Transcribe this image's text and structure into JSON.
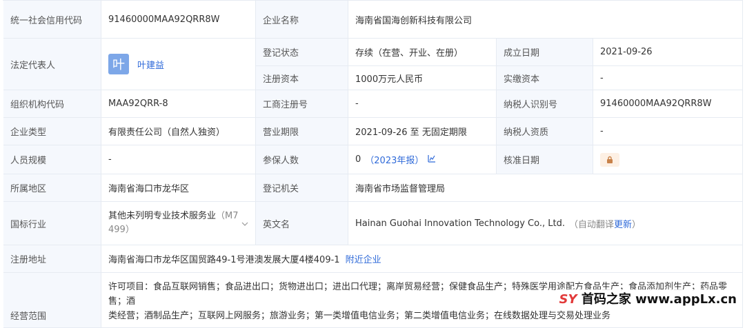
{
  "rows": {
    "credit_code": {
      "label": "统一社会信用代码",
      "value": "91460000MAA92QRR8W"
    },
    "company_name": {
      "label": "企业名称",
      "value": "海南省国海创新科技有限公司"
    },
    "legal_rep": {
      "label": "法定代表人",
      "avatar_char": "叶",
      "name": "叶建益"
    },
    "reg_status": {
      "label": "登记状态",
      "value": "存续（在营、开业、在册）"
    },
    "founded": {
      "label": "成立日期",
      "value": "2021-09-26"
    },
    "reg_capital": {
      "label": "注册资本",
      "value": "1000万元人民币"
    },
    "paid_capital": {
      "label": "实缴资本",
      "value": "-"
    },
    "org_code": {
      "label": "组织机构代码",
      "value": "MAA92QRR-8"
    },
    "biz_reg_no": {
      "label": "工商注册号",
      "value": "-"
    },
    "taxpayer_id": {
      "label": "纳税人识别号",
      "value": "91460000MAA92QRR8W"
    },
    "company_type": {
      "label": "企业类型",
      "value": "有限责任公司（自然人独资）"
    },
    "biz_term": {
      "label": "营业期限",
      "value": "2021-09-26 至 无固定期限"
    },
    "taxpayer_qual": {
      "label": "纳税人资质",
      "value": "-"
    },
    "staff_size": {
      "label": "人员规模",
      "value": "-"
    },
    "insured": {
      "label": "参保人数",
      "value": "0",
      "report": "（2023年报）"
    },
    "approved_date": {
      "label": "核准日期"
    },
    "region": {
      "label": "所属地区",
      "value": "海南省海口市龙华区"
    },
    "reg_authority": {
      "label": "登记机关",
      "value": "海南省市场监督管理局"
    },
    "industry": {
      "label": "国标行业",
      "value": "其他未列明专业技术服务业",
      "code_part1": "（M7",
      "code_part2": "499）"
    },
    "en_name": {
      "label": "英文名",
      "value": "Hainan Guohai Innovation Technology Co., Ltd.",
      "auto_prefix": "（自动翻译",
      "update_link": "更新",
      "auto_suffix": "）"
    },
    "address": {
      "label": "注册地址",
      "value": "海南省海口市龙华区国贸路49-1号港澳发展大厦4楼409-1",
      "nearby_link": "附近企业"
    },
    "scope": {
      "label": "经营范围",
      "line1": "许可项目：食品互联网销售；食品进出口；货物进出口；进出口代理；离岸贸易经营；保健食品生产；特殊医学用途配方食品生产；食品添加剂生产；药品零售；酒",
      "line2": "类经营；酒制品生产；互联网上网服务；旅游业务；第一类增值电信业务；第二类增值电信业务；在线数据处理与交易处理业务"
    }
  },
  "watermark": {
    "brand": "SY",
    "text": "首码之家 www.appLx.cn"
  }
}
